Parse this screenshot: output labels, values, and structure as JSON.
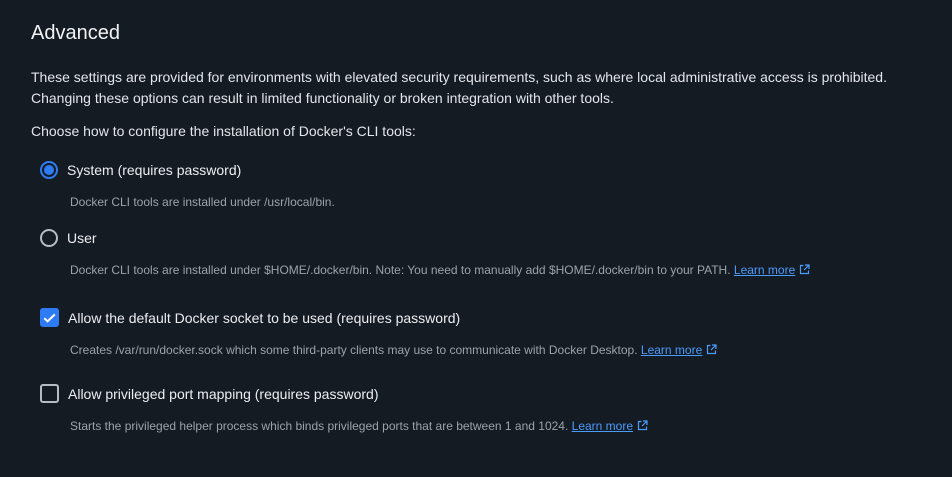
{
  "section": {
    "title": "Advanced",
    "description_line1": "These settings are provided for environments with elevated security requirements, such as where local administrative access is prohibited.",
    "description_line2": "Changing these options can result in limited functionality or broken integration with other tools.",
    "cli_prompt": "Choose how to configure the installation of Docker's CLI tools:"
  },
  "cli_install": {
    "selected": "system",
    "options": [
      {
        "id": "system",
        "label": "System (requires password)",
        "helper": "Docker CLI tools are installed under /usr/local/bin."
      },
      {
        "id": "user",
        "label": "User",
        "helper": "Docker CLI tools are installed under $HOME/.docker/bin. Note: You need to manually add $HOME/.docker/bin to your PATH.",
        "link": "Learn more"
      }
    ]
  },
  "settings": [
    {
      "id": "default-socket",
      "label": "Allow the default Docker socket to be used (requires password)",
      "checked": true,
      "helper": "Creates /var/run/docker.sock which some third-party clients may use to communicate with Docker Desktop.",
      "link": "Learn more"
    },
    {
      "id": "privileged-ports",
      "label": "Allow privileged port mapping (requires password)",
      "checked": false,
      "helper": "Starts the privileged helper process which binds privileged ports that are between 1 and 1024.",
      "link": "Learn more"
    }
  ],
  "colors": {
    "background": "#151b23",
    "accent": "#2d7cf6",
    "link": "#4b9cff",
    "muted_text": "#9aa3ad"
  },
  "icons": {
    "external_link": "external-link-icon",
    "check": "check-icon"
  }
}
